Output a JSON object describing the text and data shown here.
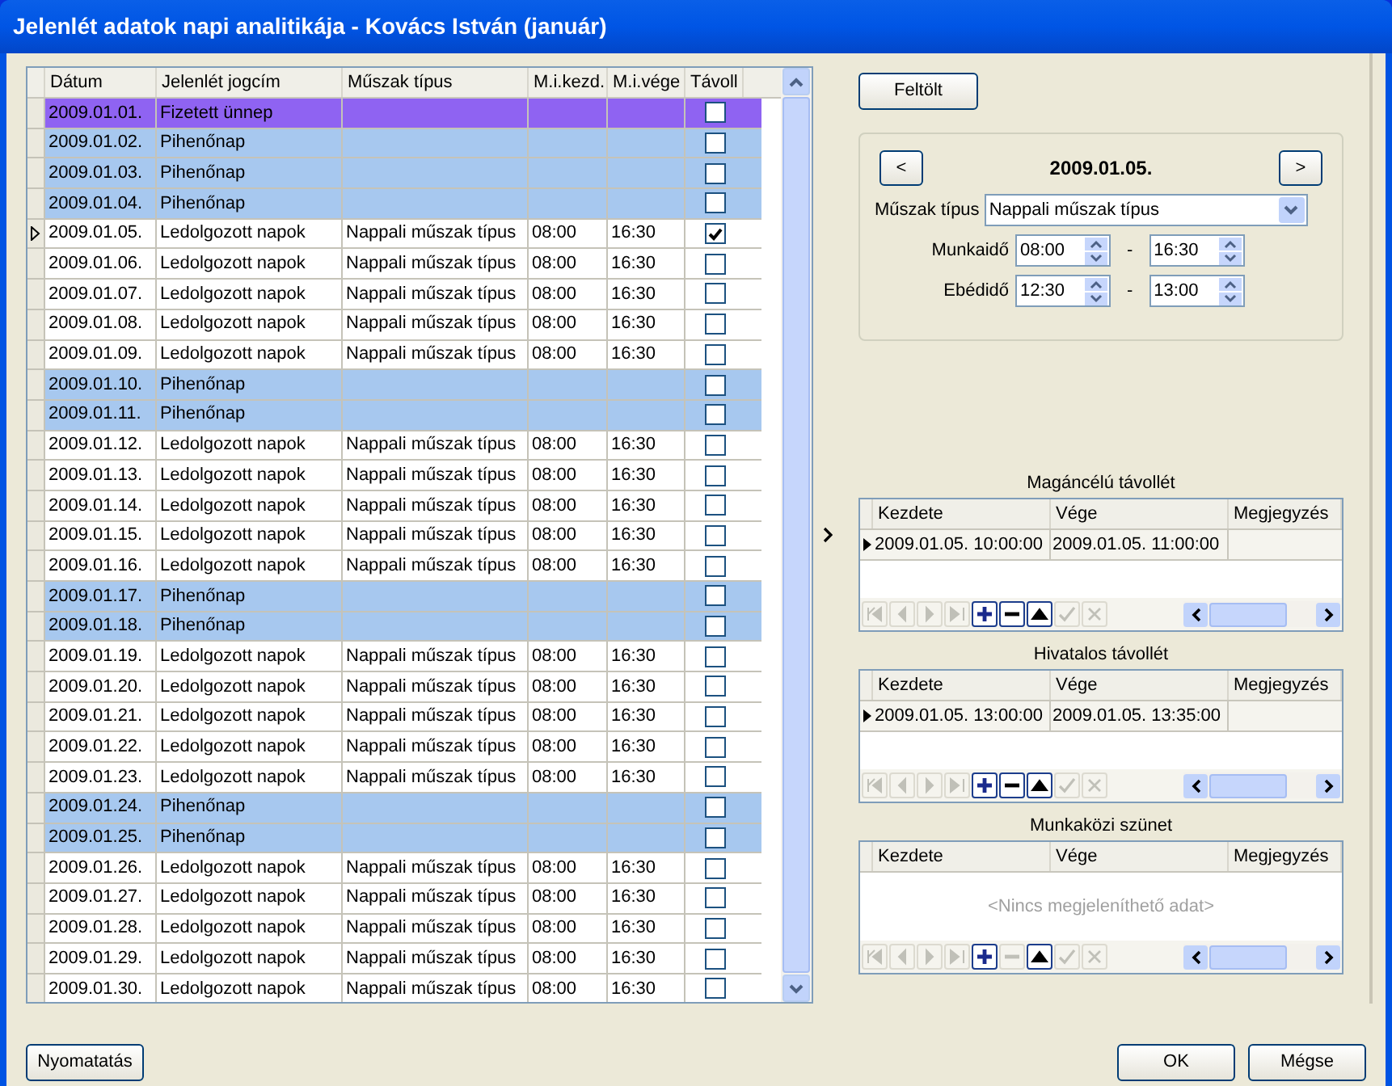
{
  "window": {
    "title": "Jelenlét adatok napi analitikája - Kovács István (január)"
  },
  "table": {
    "columns": [
      "Dátum",
      "Jelenlét jogcím",
      "Műszak típus",
      "M.i.kezd.",
      "M.i.vége",
      "Távoll"
    ],
    "rows": [
      {
        "date": "2009.01.01.",
        "type": "Fizetett ünnep",
        "kind": "holiday",
        "checked": false,
        "selected": false
      },
      {
        "date": "2009.01.02.",
        "type": "Pihenőnap",
        "kind": "rest",
        "checked": false,
        "selected": false
      },
      {
        "date": "2009.01.03.",
        "type": "Pihenőnap",
        "kind": "rest",
        "checked": false,
        "selected": false
      },
      {
        "date": "2009.01.04.",
        "type": "Pihenőnap",
        "kind": "rest",
        "checked": false,
        "selected": false
      },
      {
        "date": "2009.01.05.",
        "type": "Ledolgozott napok",
        "shift": "Nappali műszak típus",
        "start": "08:00",
        "end": "16:30",
        "kind": "work",
        "checked": true,
        "selected": true
      },
      {
        "date": "2009.01.06.",
        "type": "Ledolgozott napok",
        "shift": "Nappali műszak típus",
        "start": "08:00",
        "end": "16:30",
        "kind": "work",
        "checked": false,
        "selected": false
      },
      {
        "date": "2009.01.07.",
        "type": "Ledolgozott napok",
        "shift": "Nappali műszak típus",
        "start": "08:00",
        "end": "16:30",
        "kind": "work",
        "checked": false,
        "selected": false
      },
      {
        "date": "2009.01.08.",
        "type": "Ledolgozott napok",
        "shift": "Nappali műszak típus",
        "start": "08:00",
        "end": "16:30",
        "kind": "work",
        "checked": false,
        "selected": false
      },
      {
        "date": "2009.01.09.",
        "type": "Ledolgozott napok",
        "shift": "Nappali műszak típus",
        "start": "08:00",
        "end": "16:30",
        "kind": "work",
        "checked": false,
        "selected": false
      },
      {
        "date": "2009.01.10.",
        "type": "Pihenőnap",
        "kind": "rest",
        "checked": false,
        "selected": false
      },
      {
        "date": "2009.01.11.",
        "type": "Pihenőnap",
        "kind": "rest",
        "checked": false,
        "selected": false
      },
      {
        "date": "2009.01.12.",
        "type": "Ledolgozott napok",
        "shift": "Nappali műszak típus",
        "start": "08:00",
        "end": "16:30",
        "kind": "work",
        "checked": false,
        "selected": false
      },
      {
        "date": "2009.01.13.",
        "type": "Ledolgozott napok",
        "shift": "Nappali műszak típus",
        "start": "08:00",
        "end": "16:30",
        "kind": "work",
        "checked": false,
        "selected": false
      },
      {
        "date": "2009.01.14.",
        "type": "Ledolgozott napok",
        "shift": "Nappali műszak típus",
        "start": "08:00",
        "end": "16:30",
        "kind": "work",
        "checked": false,
        "selected": false
      },
      {
        "date": "2009.01.15.",
        "type": "Ledolgozott napok",
        "shift": "Nappali műszak típus",
        "start": "08:00",
        "end": "16:30",
        "kind": "work",
        "checked": false,
        "selected": false
      },
      {
        "date": "2009.01.16.",
        "type": "Ledolgozott napok",
        "shift": "Nappali műszak típus",
        "start": "08:00",
        "end": "16:30",
        "kind": "work",
        "checked": false,
        "selected": false
      },
      {
        "date": "2009.01.17.",
        "type": "Pihenőnap",
        "kind": "rest",
        "checked": false,
        "selected": false
      },
      {
        "date": "2009.01.18.",
        "type": "Pihenőnap",
        "kind": "rest",
        "checked": false,
        "selected": false
      },
      {
        "date": "2009.01.19.",
        "type": "Ledolgozott napok",
        "shift": "Nappali műszak típus",
        "start": "08:00",
        "end": "16:30",
        "kind": "work",
        "checked": false,
        "selected": false
      },
      {
        "date": "2009.01.20.",
        "type": "Ledolgozott napok",
        "shift": "Nappali műszak típus",
        "start": "08:00",
        "end": "16:30",
        "kind": "work",
        "checked": false,
        "selected": false
      },
      {
        "date": "2009.01.21.",
        "type": "Ledolgozott napok",
        "shift": "Nappali műszak típus",
        "start": "08:00",
        "end": "16:30",
        "kind": "work",
        "checked": false,
        "selected": false
      },
      {
        "date": "2009.01.22.",
        "type": "Ledolgozott napok",
        "shift": "Nappali műszak típus",
        "start": "08:00",
        "end": "16:30",
        "kind": "work",
        "checked": false,
        "selected": false
      },
      {
        "date": "2009.01.23.",
        "type": "Ledolgozott napok",
        "shift": "Nappali műszak típus",
        "start": "08:00",
        "end": "16:30",
        "kind": "work",
        "checked": false,
        "selected": false
      },
      {
        "date": "2009.01.24.",
        "type": "Pihenőnap",
        "kind": "rest",
        "checked": false,
        "selected": false
      },
      {
        "date": "2009.01.25.",
        "type": "Pihenőnap",
        "kind": "rest",
        "checked": false,
        "selected": false
      },
      {
        "date": "2009.01.26.",
        "type": "Ledolgozott napok",
        "shift": "Nappali műszak típus",
        "start": "08:00",
        "end": "16:30",
        "kind": "work",
        "checked": false,
        "selected": false
      },
      {
        "date": "2009.01.27.",
        "type": "Ledolgozott napok",
        "shift": "Nappali műszak típus",
        "start": "08:00",
        "end": "16:30",
        "kind": "work",
        "checked": false,
        "selected": false
      },
      {
        "date": "2009.01.28.",
        "type": "Ledolgozott napok",
        "shift": "Nappali műszak típus",
        "start": "08:00",
        "end": "16:30",
        "kind": "work",
        "checked": false,
        "selected": false
      },
      {
        "date": "2009.01.29.",
        "type": "Ledolgozott napok",
        "shift": "Nappali műszak típus",
        "start": "08:00",
        "end": "16:30",
        "kind": "work",
        "checked": false,
        "selected": false
      },
      {
        "date": "2009.01.30.",
        "type": "Ledolgozott napok",
        "shift": "Nappali műszak típus",
        "start": "08:00",
        "end": "16:30",
        "kind": "work",
        "checked": false,
        "selected": false
      }
    ]
  },
  "detail": {
    "upload_button": "Feltölt",
    "prev_button": "<",
    "date": "2009.01.05.",
    "next_button": ">",
    "shift_label": "Műszak típus",
    "shift_value": "Nappali műszak típus",
    "times": [
      {
        "label": "Munkaidő",
        "from": "08:00",
        "separator": "-",
        "to": "16:30"
      },
      {
        "label": "Ebédidő",
        "from": "12:30",
        "separator": "-",
        "to": "13:00"
      }
    ]
  },
  "subgrids": [
    {
      "title": "Magáncélú távollét",
      "columns": [
        "Kezdete",
        "Vége",
        "Megjegyzés"
      ],
      "rows": [
        {
          "start": "2009.01.05. 10:00:00",
          "end": "2009.01.05. 11:00:00",
          "selected": true
        }
      ],
      "navigator": [
        {
          "kind": "first",
          "disabled": true
        },
        {
          "kind": "prev",
          "disabled": true
        },
        {
          "kind": "next",
          "disabled": true
        },
        {
          "kind": "last",
          "disabled": true
        },
        {
          "kind": "add",
          "disabled": false
        },
        {
          "kind": "remove",
          "disabled": false
        },
        {
          "kind": "up",
          "disabled": false
        },
        {
          "kind": "ok",
          "disabled": true
        },
        {
          "kind": "cancel",
          "disabled": true
        }
      ]
    },
    {
      "title": "Hivatalos távollét",
      "columns": [
        "Kezdete",
        "Vége",
        "Megjegyzés"
      ],
      "rows": [
        {
          "start": "2009.01.05. 13:00:00",
          "end": "2009.01.05. 13:35:00",
          "selected": true
        }
      ],
      "navigator": [
        {
          "kind": "first",
          "disabled": true
        },
        {
          "kind": "prev",
          "disabled": true
        },
        {
          "kind": "next",
          "disabled": true
        },
        {
          "kind": "last",
          "disabled": true
        },
        {
          "kind": "add",
          "disabled": false
        },
        {
          "kind": "remove",
          "disabled": false
        },
        {
          "kind": "up",
          "disabled": false
        },
        {
          "kind": "ok",
          "disabled": true
        },
        {
          "kind": "cancel",
          "disabled": true
        }
      ]
    },
    {
      "title": "Munkaközi szünet",
      "columns": [
        "Kezdete",
        "Vége",
        "Megjegyzés"
      ],
      "empty_text": "<Nincs megjeleníthető adat>",
      "navigator": [
        {
          "kind": "first",
          "disabled": true
        },
        {
          "kind": "prev",
          "disabled": true
        },
        {
          "kind": "next",
          "disabled": true
        },
        {
          "kind": "last",
          "disabled": true
        },
        {
          "kind": "add",
          "disabled": false
        },
        {
          "kind": "remove",
          "disabled": true
        },
        {
          "kind": "up",
          "disabled": false
        },
        {
          "kind": "ok",
          "disabled": true
        },
        {
          "kind": "cancel",
          "disabled": true
        }
      ]
    }
  ],
  "footer": {
    "print_button": "Nyomatatás",
    "ok_button": "OK",
    "cancel_button": "Mégse"
  }
}
